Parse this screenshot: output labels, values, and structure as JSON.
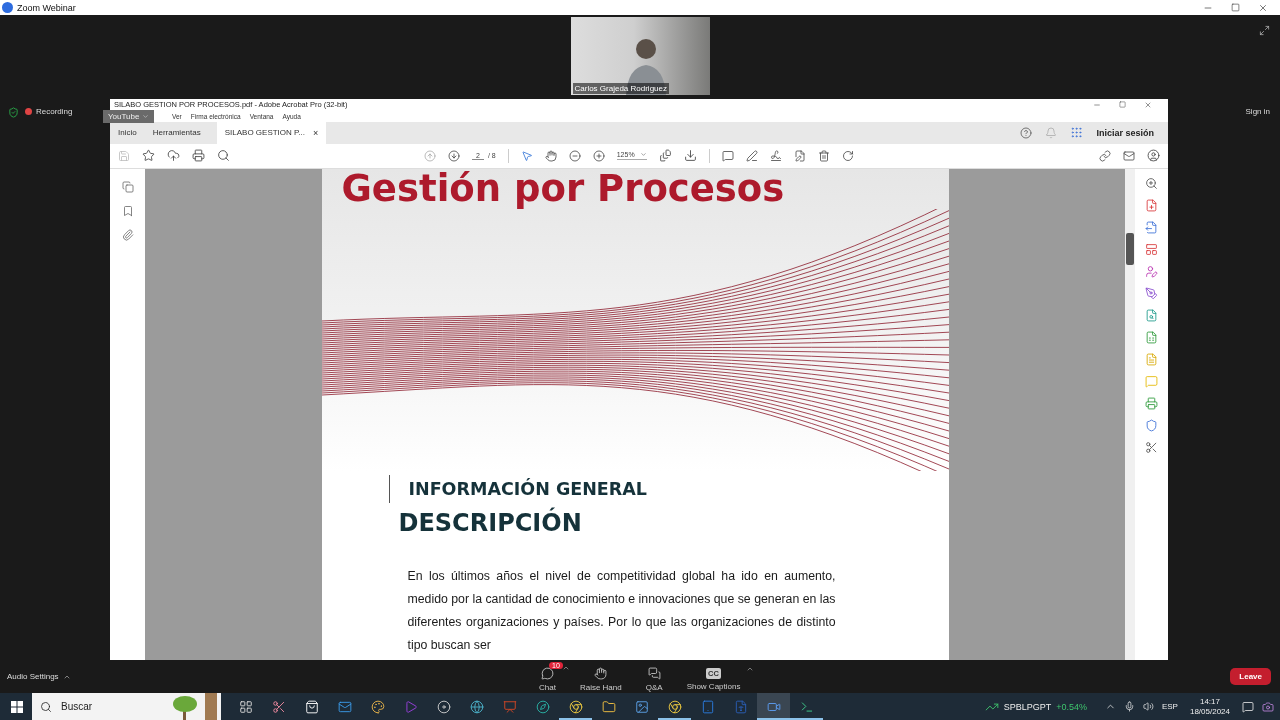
{
  "app": {
    "title": "Zoom Webinar"
  },
  "speaker": {
    "name": "Carlos Grajeda Rodriguez"
  },
  "status": {
    "recording": "Recording",
    "stream": "YouTube"
  },
  "sign_in": "Sign in",
  "acrobat": {
    "title": "SILABO GESTION POR PROCESOS.pdf - Adobe Acrobat Pro (32-bit)",
    "menu": [
      "Ver",
      "Firma electrónica",
      "Ventana",
      "Ayuda"
    ],
    "tabs": [
      {
        "label": "Inicio",
        "selected": false
      },
      {
        "label": "Herramientas",
        "selected": false
      },
      {
        "label": "SILABO GESTION P...",
        "selected": true
      }
    ],
    "close_tab": "×",
    "sign_in": "Iniciar sesión",
    "page_current": "2",
    "page_total": "/ 8",
    "zoom": "125%"
  },
  "document": {
    "title": "Gestión por Procesos",
    "section": "INFORMACIÓN GENERAL",
    "heading": "DESCRIPCIÓN",
    "paragraph": "En los últimos años el nivel de competitividad global ha ido en aumento, medido por la cantidad de conocimiento e innovaciones que se generan en las diferentes organizaciones y países. Por lo que las organizaciones de distinto tipo buscan ser"
  },
  "controls": {
    "audio": "Audio Settings",
    "buttons": [
      {
        "kind": "chat",
        "label": "Chat",
        "badge": "10"
      },
      {
        "kind": "hand",
        "label": "Raise Hand"
      },
      {
        "kind": "qa",
        "label": "Q&A"
      },
      {
        "kind": "cc",
        "label": "Show Captions",
        "icon_text": "CC"
      }
    ],
    "leave": "Leave"
  },
  "taskbar": {
    "search_placeholder": "Buscar",
    "apps": [
      {
        "kind": "taskview",
        "running": false,
        "active": false
      },
      {
        "kind": "snip",
        "running": false,
        "active": false
      },
      {
        "kind": "store",
        "running": false,
        "active": false
      },
      {
        "kind": "mail",
        "running": false,
        "active": false
      },
      {
        "kind": "paint",
        "running": false,
        "active": false
      },
      {
        "kind": "video",
        "running": false,
        "active": false
      },
      {
        "kind": "disc",
        "running": false,
        "active": false
      },
      {
        "kind": "globe",
        "running": false,
        "active": false
      },
      {
        "kind": "slides",
        "running": false,
        "active": false
      },
      {
        "kind": "edge",
        "running": false,
        "active": false
      },
      {
        "kind": "chrome",
        "running": true,
        "active": false
      },
      {
        "kind": "folder",
        "running": false,
        "active": false
      },
      {
        "kind": "photos",
        "running": false,
        "active": false
      },
      {
        "kind": "chrome",
        "running": true,
        "active": false
      },
      {
        "kind": "tablet",
        "running": false,
        "active": false
      },
      {
        "kind": "doc",
        "running": false,
        "active": false
      },
      {
        "kind": "zoom",
        "running": true,
        "active": true
      },
      {
        "kind": "terminal",
        "running": true,
        "active": false
      }
    ],
    "stock": {
      "symbol": "SPBLPGPT",
      "change": "+0.54%"
    },
    "language": "ESP",
    "time": "14:17",
    "date": "18/05/2024"
  }
}
